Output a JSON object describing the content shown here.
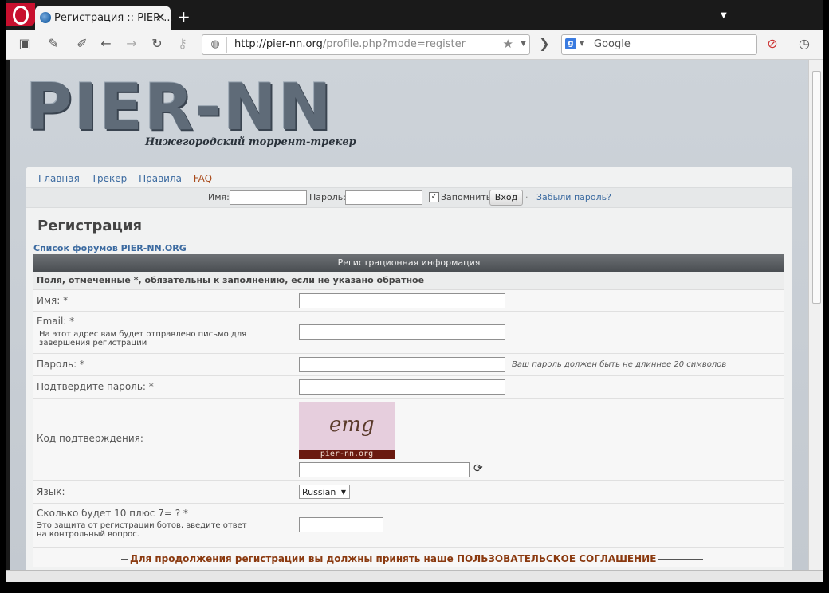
{
  "browser": {
    "tab_title": "Регистрация :: PIER-...",
    "tab_close": "✕",
    "new_tab": "+",
    "url_host": "http://pier-nn.org",
    "url_path": "/profile.php?mode=register",
    "search_engine_letter": "g",
    "search_placeholder": "Google"
  },
  "site": {
    "logo_text": "PIER-NN",
    "logo_subtitle": "Нижегородский торрент-трекер",
    "nav": [
      "Главная",
      "Трекер",
      "Правила",
      "FAQ"
    ],
    "login": {
      "name_label": "Имя:",
      "password_label": "Пароль:",
      "remember_label": "Запомнить",
      "remember_checked": true,
      "login_button": "Вход",
      "forgot_link": "Забыли пароль?"
    }
  },
  "page": {
    "title": "Регистрация",
    "breadcrumb": "Список форумов PIER-NN.ORG",
    "section_header": "Регистрационная информация",
    "required_note": "Поля, отмеченные *, обязательны к заполнению, если не указано обратное",
    "fields": {
      "name": "Имя: *",
      "email": "Email: *",
      "email_sub": "На этот адрес вам будет отправлено письмо для завершения регистрации",
      "password": "Пароль: *",
      "password_hint": "Ваш пароль должен быть не длиннее 20 символов",
      "confirm": "Подтвердите пароль: *",
      "captcha": "Код подтверждения:",
      "captcha_text": "emg",
      "captcha_caption": "pier-nn.org",
      "language": "Язык:",
      "language_value": "Russian",
      "question": "Сколько будет 10 плюс 7= ? *",
      "question_sub": "Это защита от регистрации ботов, введите ответ на контрольный вопрос."
    },
    "agreement": "Для продолжения регистрации вы должны принять наше ПОЛЬЗОВАТЕЛЬСКОЕ СОГЛАШЕНИЕ"
  }
}
